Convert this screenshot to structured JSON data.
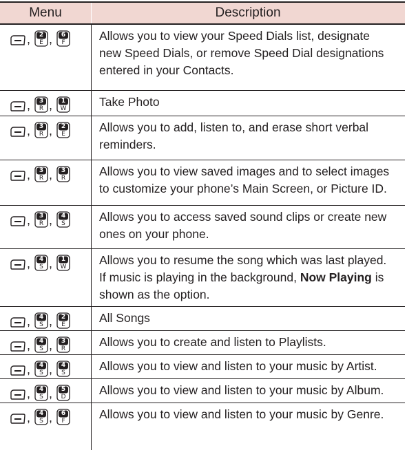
{
  "header": {
    "menu": "Menu",
    "description": "Description"
  },
  "icons": {
    "soft_key": "menu-soft-key-icon",
    "keypad": "keypad-key-icon"
  },
  "rows": [
    {
      "keys": [
        [
          "2",
          "E"
        ],
        [
          "6",
          "F"
        ]
      ],
      "lines": [
        "Allows you to view your Speed Dials list, designate",
        "new Speed Dials, or remove Speed Dial designations",
        "entered in your Contacts."
      ]
    },
    {
      "keys": [
        [
          "3",
          "R"
        ],
        [
          "1",
          "W"
        ]
      ],
      "lines": [
        "Take Photo"
      ]
    },
    {
      "keys": [
        [
          "3",
          "R"
        ],
        [
          "2",
          "E"
        ]
      ],
      "lines": [
        "Allows you to add, listen to, and erase short verbal",
        "reminders."
      ]
    },
    {
      "keys": [
        [
          "3",
          "R"
        ],
        [
          "3",
          "R"
        ]
      ],
      "lines": [
        "Allows you to view saved images and to select images",
        "to customize your phone’s Main Screen, or Picture ID."
      ]
    },
    {
      "keys": [
        [
          "3",
          "R"
        ],
        [
          "4",
          "S"
        ]
      ],
      "lines": [
        "Allows you to access saved sound clips or create new",
        "ones on your phone."
      ]
    },
    {
      "keys": [
        [
          "4",
          "S"
        ],
        [
          "1",
          "W"
        ]
      ],
      "lines": [
        "Allows you to resume the song which was last played.",
        "If music is playing in the background, ",
        "shown as the option."
      ],
      "bold": "Now Playing",
      "after": " is"
    },
    {
      "keys": [
        [
          "4",
          "S"
        ],
        [
          "2",
          "E"
        ]
      ],
      "lines": [
        "All Songs"
      ]
    },
    {
      "keys": [
        [
          "4",
          "S"
        ],
        [
          "3",
          "R"
        ]
      ],
      "lines": [
        "Allows you to create and listen to Playlists."
      ]
    },
    {
      "keys": [
        [
          "4",
          "S"
        ],
        [
          "4",
          "S"
        ]
      ],
      "lines": [
        "Allows you to view and listen to your music by Artist."
      ]
    },
    {
      "keys": [
        [
          "4",
          "S"
        ],
        [
          "5",
          "D"
        ]
      ],
      "lines": [
        "Allows you to view and listen to your music by Album."
      ]
    },
    {
      "keys": [
        [
          "4",
          "S"
        ],
        [
          "6",
          "F"
        ]
      ],
      "lines": [
        "Allows you to view and listen to your music by Genre."
      ]
    }
  ]
}
